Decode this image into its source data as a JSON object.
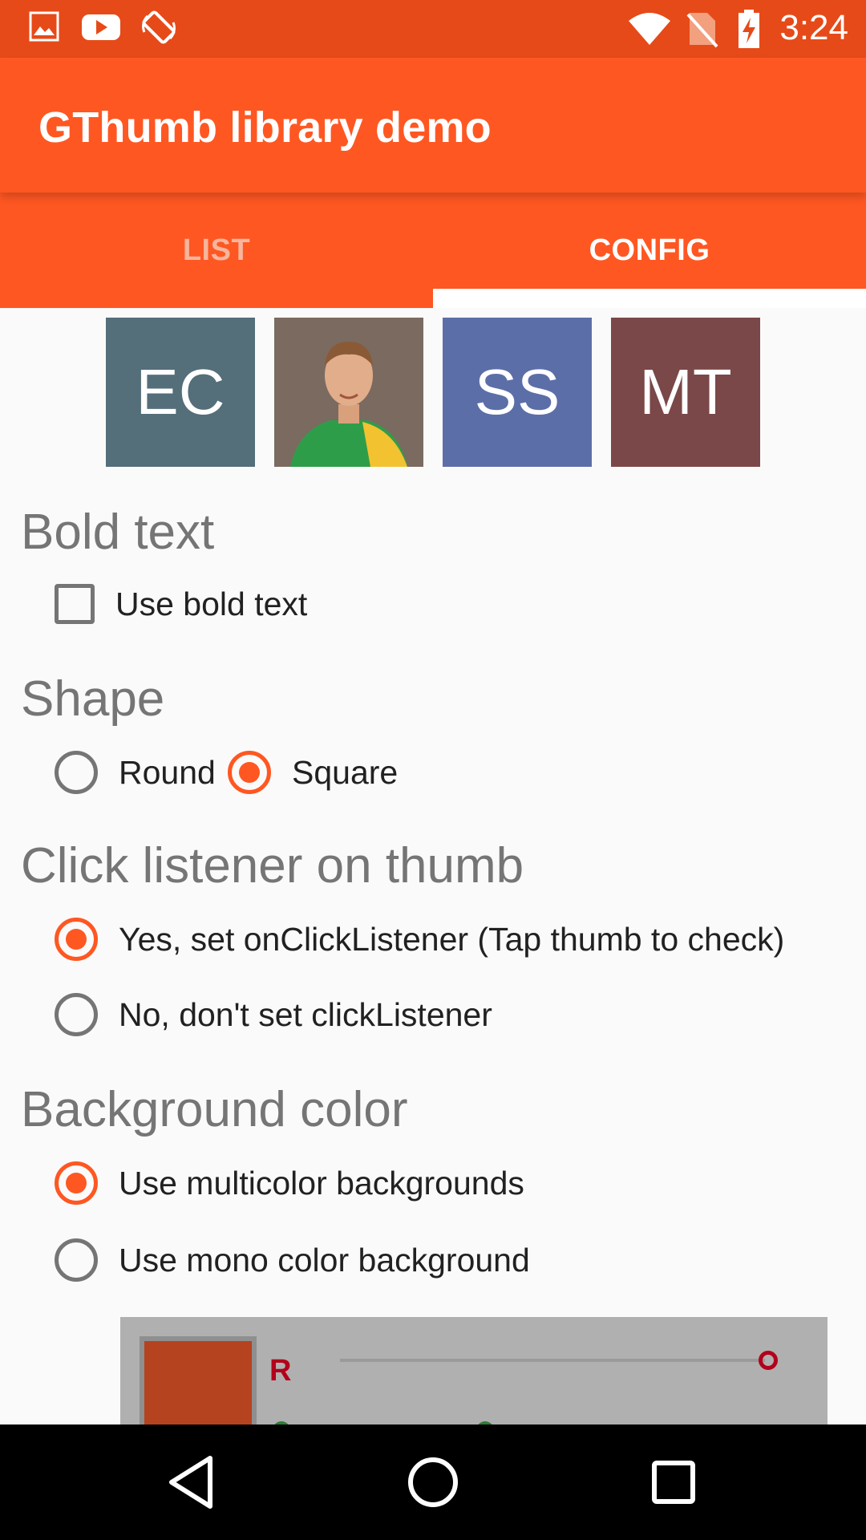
{
  "status_bar": {
    "time": "3:24",
    "icons": [
      "image-icon",
      "youtube-icon",
      "screen-rotation-icon",
      "wifi-icon",
      "no-sim-icon",
      "battery-charging-icon"
    ]
  },
  "app_bar": {
    "title": "GThumb library demo"
  },
  "tabs": [
    {
      "label": "LIST",
      "selected": false
    },
    {
      "label": "CONFIG",
      "selected": true
    }
  ],
  "thumbs": [
    {
      "type": "initials",
      "text": "EC",
      "color": "#546e7a"
    },
    {
      "type": "photo",
      "text": "",
      "color": "#7a6a5f"
    },
    {
      "type": "initials",
      "text": "SS",
      "color": "#5c6ea8"
    },
    {
      "type": "initials",
      "text": "MT",
      "color": "#7a4848"
    }
  ],
  "bold_text": {
    "title": "Bold text",
    "checkbox_label": "Use bold text",
    "checked": false
  },
  "shape": {
    "title": "Shape",
    "options": [
      {
        "label": "Round",
        "selected": false
      },
      {
        "label": "Square",
        "selected": true
      }
    ]
  },
  "click_listener": {
    "title": "Click listener on thumb",
    "options": [
      {
        "label": "Yes, set onClickListener (Tap thumb to check)",
        "selected": true
      },
      {
        "label": "No, don't set clickListener",
        "selected": false
      }
    ]
  },
  "background_color": {
    "title": "Background color",
    "options": [
      {
        "label": "Use multicolor backgrounds",
        "selected": true
      },
      {
        "label": "Use mono color background",
        "selected": false
      }
    ],
    "picker": {
      "channel_label": "R",
      "swatch_color": "#b5431f",
      "red_level": 1.0
    }
  },
  "colors": {
    "primary": "#ff5722",
    "primary_dark": "#e64a19"
  }
}
